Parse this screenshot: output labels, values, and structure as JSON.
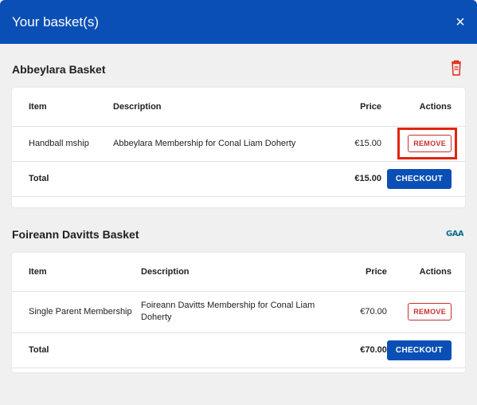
{
  "modal": {
    "title": "Your basket(s)",
    "close_label": "×"
  },
  "columns": {
    "item": "Item",
    "description": "Description",
    "price": "Price",
    "actions": "Actions"
  },
  "baskets": [
    {
      "title": "Abbeylara Basket",
      "icon": "trash-icon",
      "items": [
        {
          "item": "Handball mship",
          "description": "Abbeylara Membership for Conal Liam Doherty",
          "price": "€15.00",
          "remove_label": "REMOVE"
        }
      ],
      "total_label": "Total",
      "total": "€15.00",
      "checkout_label": "CHECKOUT"
    },
    {
      "title": "Foireann Davitts Basket",
      "icon": "gaa-logo-icon",
      "items": [
        {
          "item": "Single Parent Membership",
          "description": "Foireann Davitts Membership for Conal Liam Doherty",
          "price": "€70.00",
          "remove_label": "REMOVE"
        }
      ],
      "total_label": "Total",
      "total": "€70.00",
      "checkout_label": "CHECKOUT"
    }
  ],
  "colors": {
    "header": "#0a4fb5",
    "remove": "#c9302c",
    "highlight": "#e2230f"
  }
}
